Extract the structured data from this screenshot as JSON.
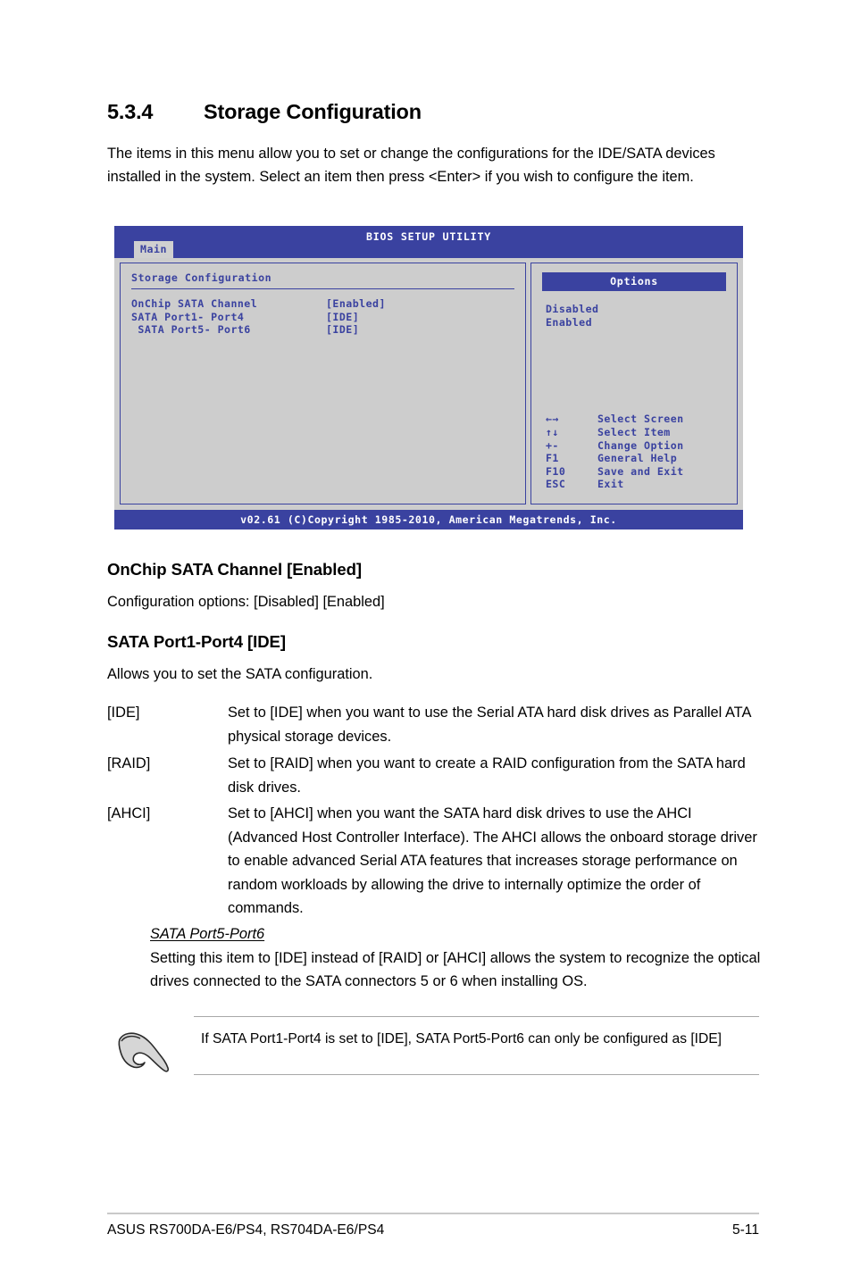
{
  "section": {
    "number": "5.3.4",
    "title": "Storage Configuration",
    "intro": "The items in this menu allow you to set or change the configurations for the IDE/SATA devices installed in the system. Select an item then press <Enter> if you wish to configure the item."
  },
  "bios": {
    "title": "BIOS SETUP UTILITY",
    "tab": "Main",
    "panel_heading": "Storage Configuration",
    "items": [
      {
        "label": "OnChip SATA Channel",
        "value": "[Enabled]"
      },
      {
        "label": "SATA Port1- Port4",
        "value": "[IDE]"
      },
      {
        "label": " SATA Port5- Port6",
        "value": "[IDE]"
      }
    ],
    "options_header": "Options",
    "options": [
      "Disabled",
      "Enabled"
    ],
    "keys": [
      {
        "key": "←→",
        "desc": "Select Screen"
      },
      {
        "key": "↑↓",
        "desc": "Select Item"
      },
      {
        "key": "+-",
        "desc": "Change Option"
      },
      {
        "key": "F1",
        "desc": "General Help"
      },
      {
        "key": "F10",
        "desc": "Save and Exit"
      },
      {
        "key": "ESC",
        "desc": "Exit"
      }
    ],
    "footer": "v02.61 (C)Copyright 1985-2010, American Megatrends, Inc.",
    "colors": {
      "chrome_blue": "#3a42a0",
      "panel_gray": "#cdcdcd",
      "tab_gray": "#d0d0d0"
    }
  },
  "onchip": {
    "heading": "OnChip SATA Channel [Enabled]",
    "options_line": "Configuration options: [Disabled] [Enabled]"
  },
  "sata14": {
    "heading": "SATA Port1-Port4 [IDE]",
    "description": "Allows you to set the SATA configuration.",
    "definitions": [
      {
        "term": "[IDE]",
        "desc": "Set to [IDE] when you want to use the Serial ATA hard disk drives as Parallel ATA physical storage devices."
      },
      {
        "term": "[RAID]",
        "desc": "Set to [RAID] when you want to create a RAID configuration from the SATA hard disk drives."
      },
      {
        "term": "[AHCI]",
        "desc": "Set to [AHCI] when you want the SATA hard disk drives to use the AHCI (Advanced Host Controller Interface). The AHCI allows the onboard storage driver to enable advanced Serial ATA features that increases storage performance on random workloads by allowing the drive to internally optimize the order of commands."
      }
    ]
  },
  "sata56": {
    "title": "SATA Port5-Port6",
    "body": "Setting this item to [IDE] instead of [RAID] or [AHCI] allows the system to recognize the optical drives connected to the SATA connectors 5 or 6 when installing OS."
  },
  "note": {
    "icon": "pointing-hand-icon",
    "text": "If SATA Port1-Port4 is set to [IDE], SATA Port5-Port6 can only be configured as [IDE]"
  },
  "footer": {
    "left": "ASUS RS700DA-E6/PS4, RS704DA-E6/PS4",
    "right": "5-11"
  }
}
